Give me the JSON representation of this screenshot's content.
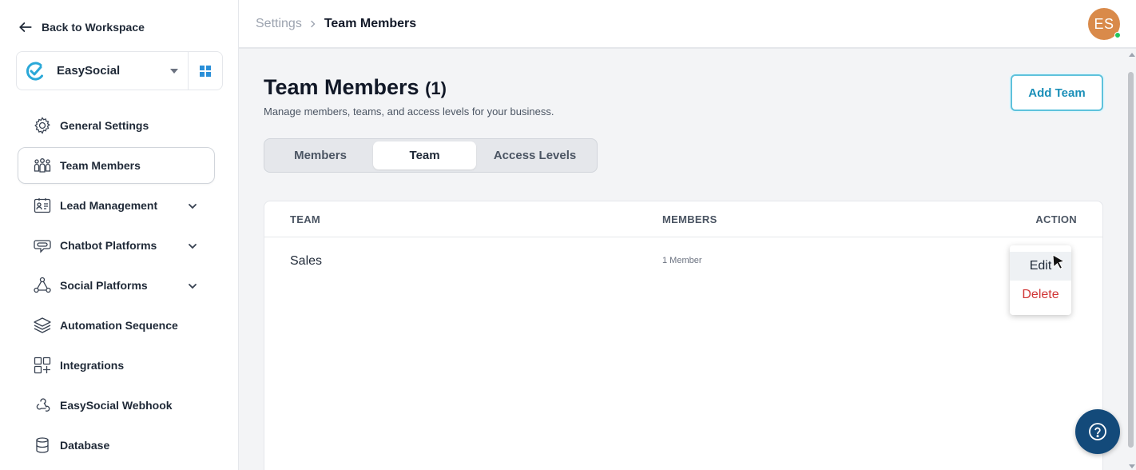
{
  "sidebar": {
    "back_label": "Back to Workspace",
    "workspace_name": "EasySocial",
    "items": [
      {
        "label": "General Settings",
        "icon": "gear-icon",
        "active": false,
        "expandable": false
      },
      {
        "label": "Team Members",
        "icon": "team-icon",
        "active": true,
        "expandable": false
      },
      {
        "label": "Lead Management",
        "icon": "id-card-icon",
        "active": false,
        "expandable": true
      },
      {
        "label": "Chatbot Platforms",
        "icon": "chatbot-icon",
        "active": false,
        "expandable": true
      },
      {
        "label": "Social Platforms",
        "icon": "share-icon",
        "active": false,
        "expandable": true
      },
      {
        "label": "Automation Sequence",
        "icon": "layers-icon",
        "active": false,
        "expandable": false
      },
      {
        "label": "Integrations",
        "icon": "apps-icon",
        "active": false,
        "expandable": false
      },
      {
        "label": "EasySocial Webhook",
        "icon": "webhook-icon",
        "active": false,
        "expandable": false
      },
      {
        "label": "Database",
        "icon": "database-icon",
        "active": false,
        "expandable": false
      }
    ]
  },
  "header": {
    "breadcrumb_parent": "Settings",
    "breadcrumb_separator": ">",
    "breadcrumb_current": "Team Members",
    "avatar_initials": "ES"
  },
  "main": {
    "title": "Team Members",
    "count": "(1)",
    "subtitle": "Manage members, teams, and access levels for your business.",
    "add_button": "Add Team",
    "tabs": [
      {
        "label": "Members",
        "active": false
      },
      {
        "label": "Team",
        "active": true
      },
      {
        "label": "Access Levels",
        "active": false
      }
    ],
    "table": {
      "headers": [
        "TEAM",
        "MEMBERS",
        "ACTION"
      ],
      "rows": [
        {
          "team": "Sales",
          "members": "1 Member"
        }
      ]
    },
    "action_menu": {
      "edit": "Edit",
      "delete": "Delete"
    }
  },
  "colors": {
    "accent": "#1a8fb8",
    "brand_dark": "#134a7a",
    "danger": "#d03434",
    "avatar": "#d98a4a"
  }
}
